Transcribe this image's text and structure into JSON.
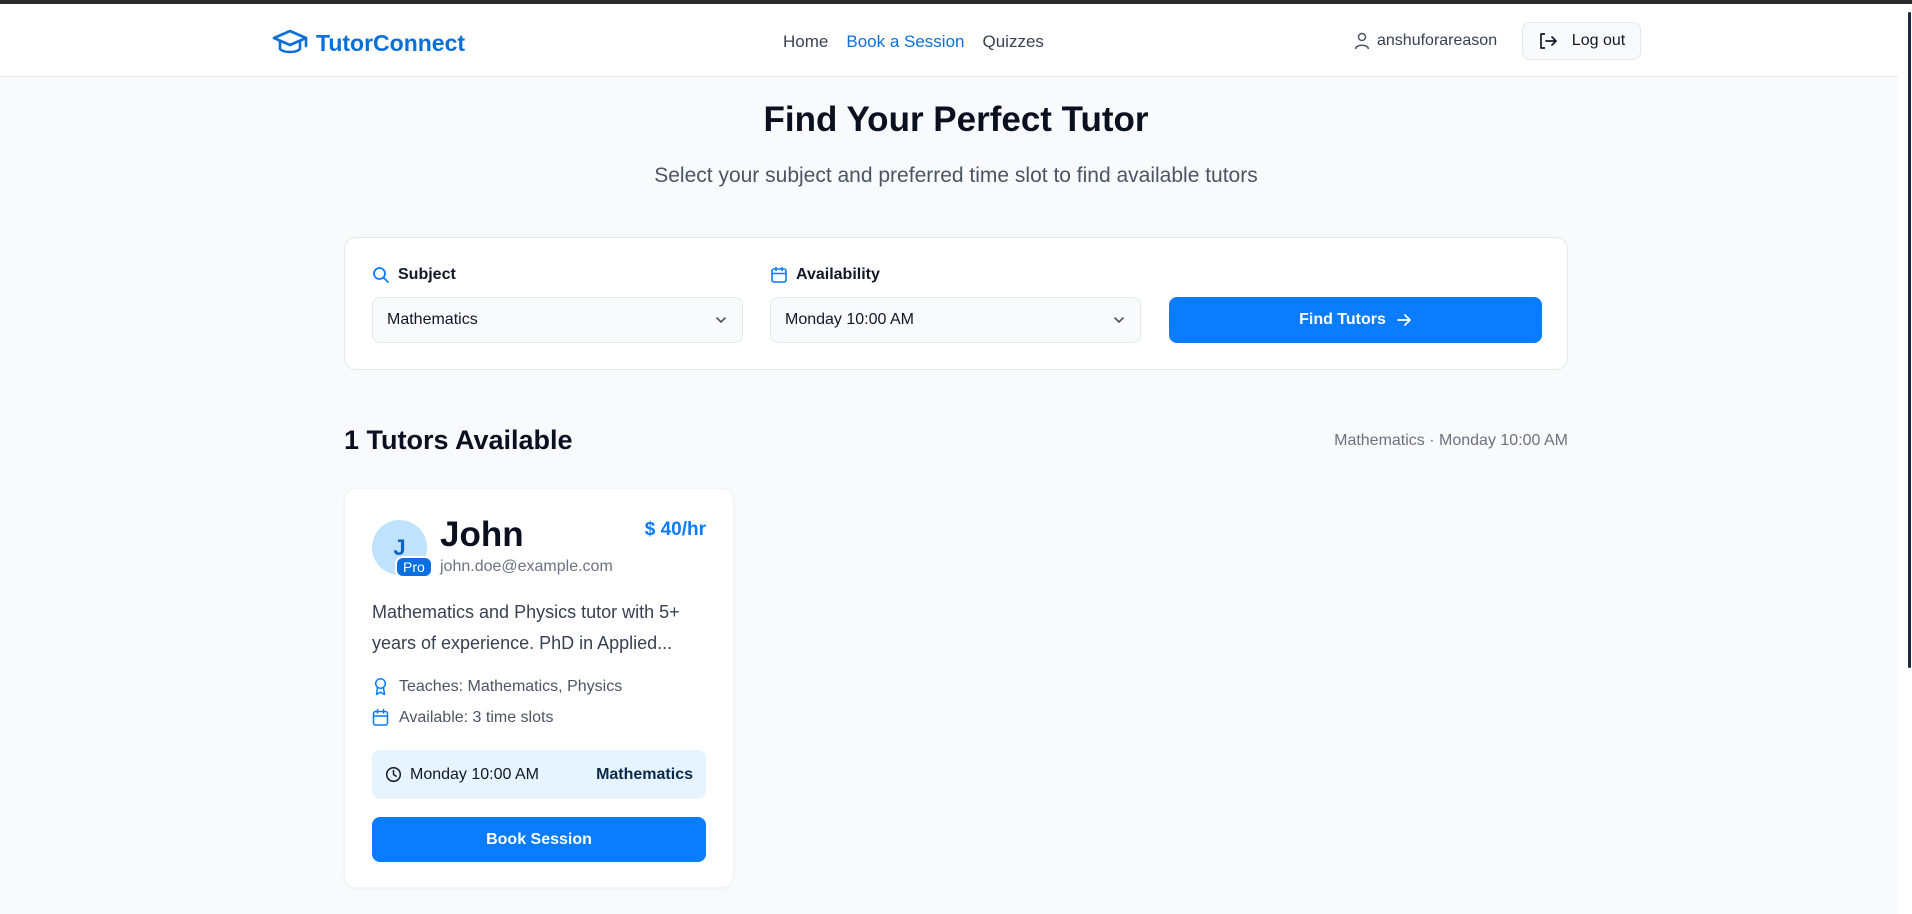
{
  "header": {
    "brand": "TutorConnect",
    "nav": [
      {
        "label": "Home",
        "active": false
      },
      {
        "label": "Book a Session",
        "active": true
      },
      {
        "label": "Quizzes",
        "active": false
      }
    ],
    "username": "anshuforareason",
    "logout_label": "Log out",
    "accent": "#0b6fd8"
  },
  "hero": {
    "title": "Find Your Perfect Tutor",
    "subtitle": "Select your subject and preferred time slot to find available tutors"
  },
  "filters": {
    "subject_label": "Subject",
    "subject_value": "Mathematics",
    "availability_label": "Availability",
    "availability_value": "Monday 10:00 AM",
    "find_label": "Find Tutors"
  },
  "results": {
    "title": "1 Tutors Available",
    "meta": "Mathematics · Monday 10:00 AM"
  },
  "tutor": {
    "initial": "J",
    "badge": "Pro",
    "name": "John",
    "email": "john.doe@example.com",
    "rate": "40/hr",
    "bio": "Mathematics and Physics tutor with 5+ years of experience. PhD in Applied...",
    "teaches": "Teaches: Mathematics, Physics",
    "available": "Available: 3 time slots",
    "slot_time": "Monday 10:00 AM",
    "slot_subject": "Mathematics",
    "book_label": "Book Session"
  }
}
